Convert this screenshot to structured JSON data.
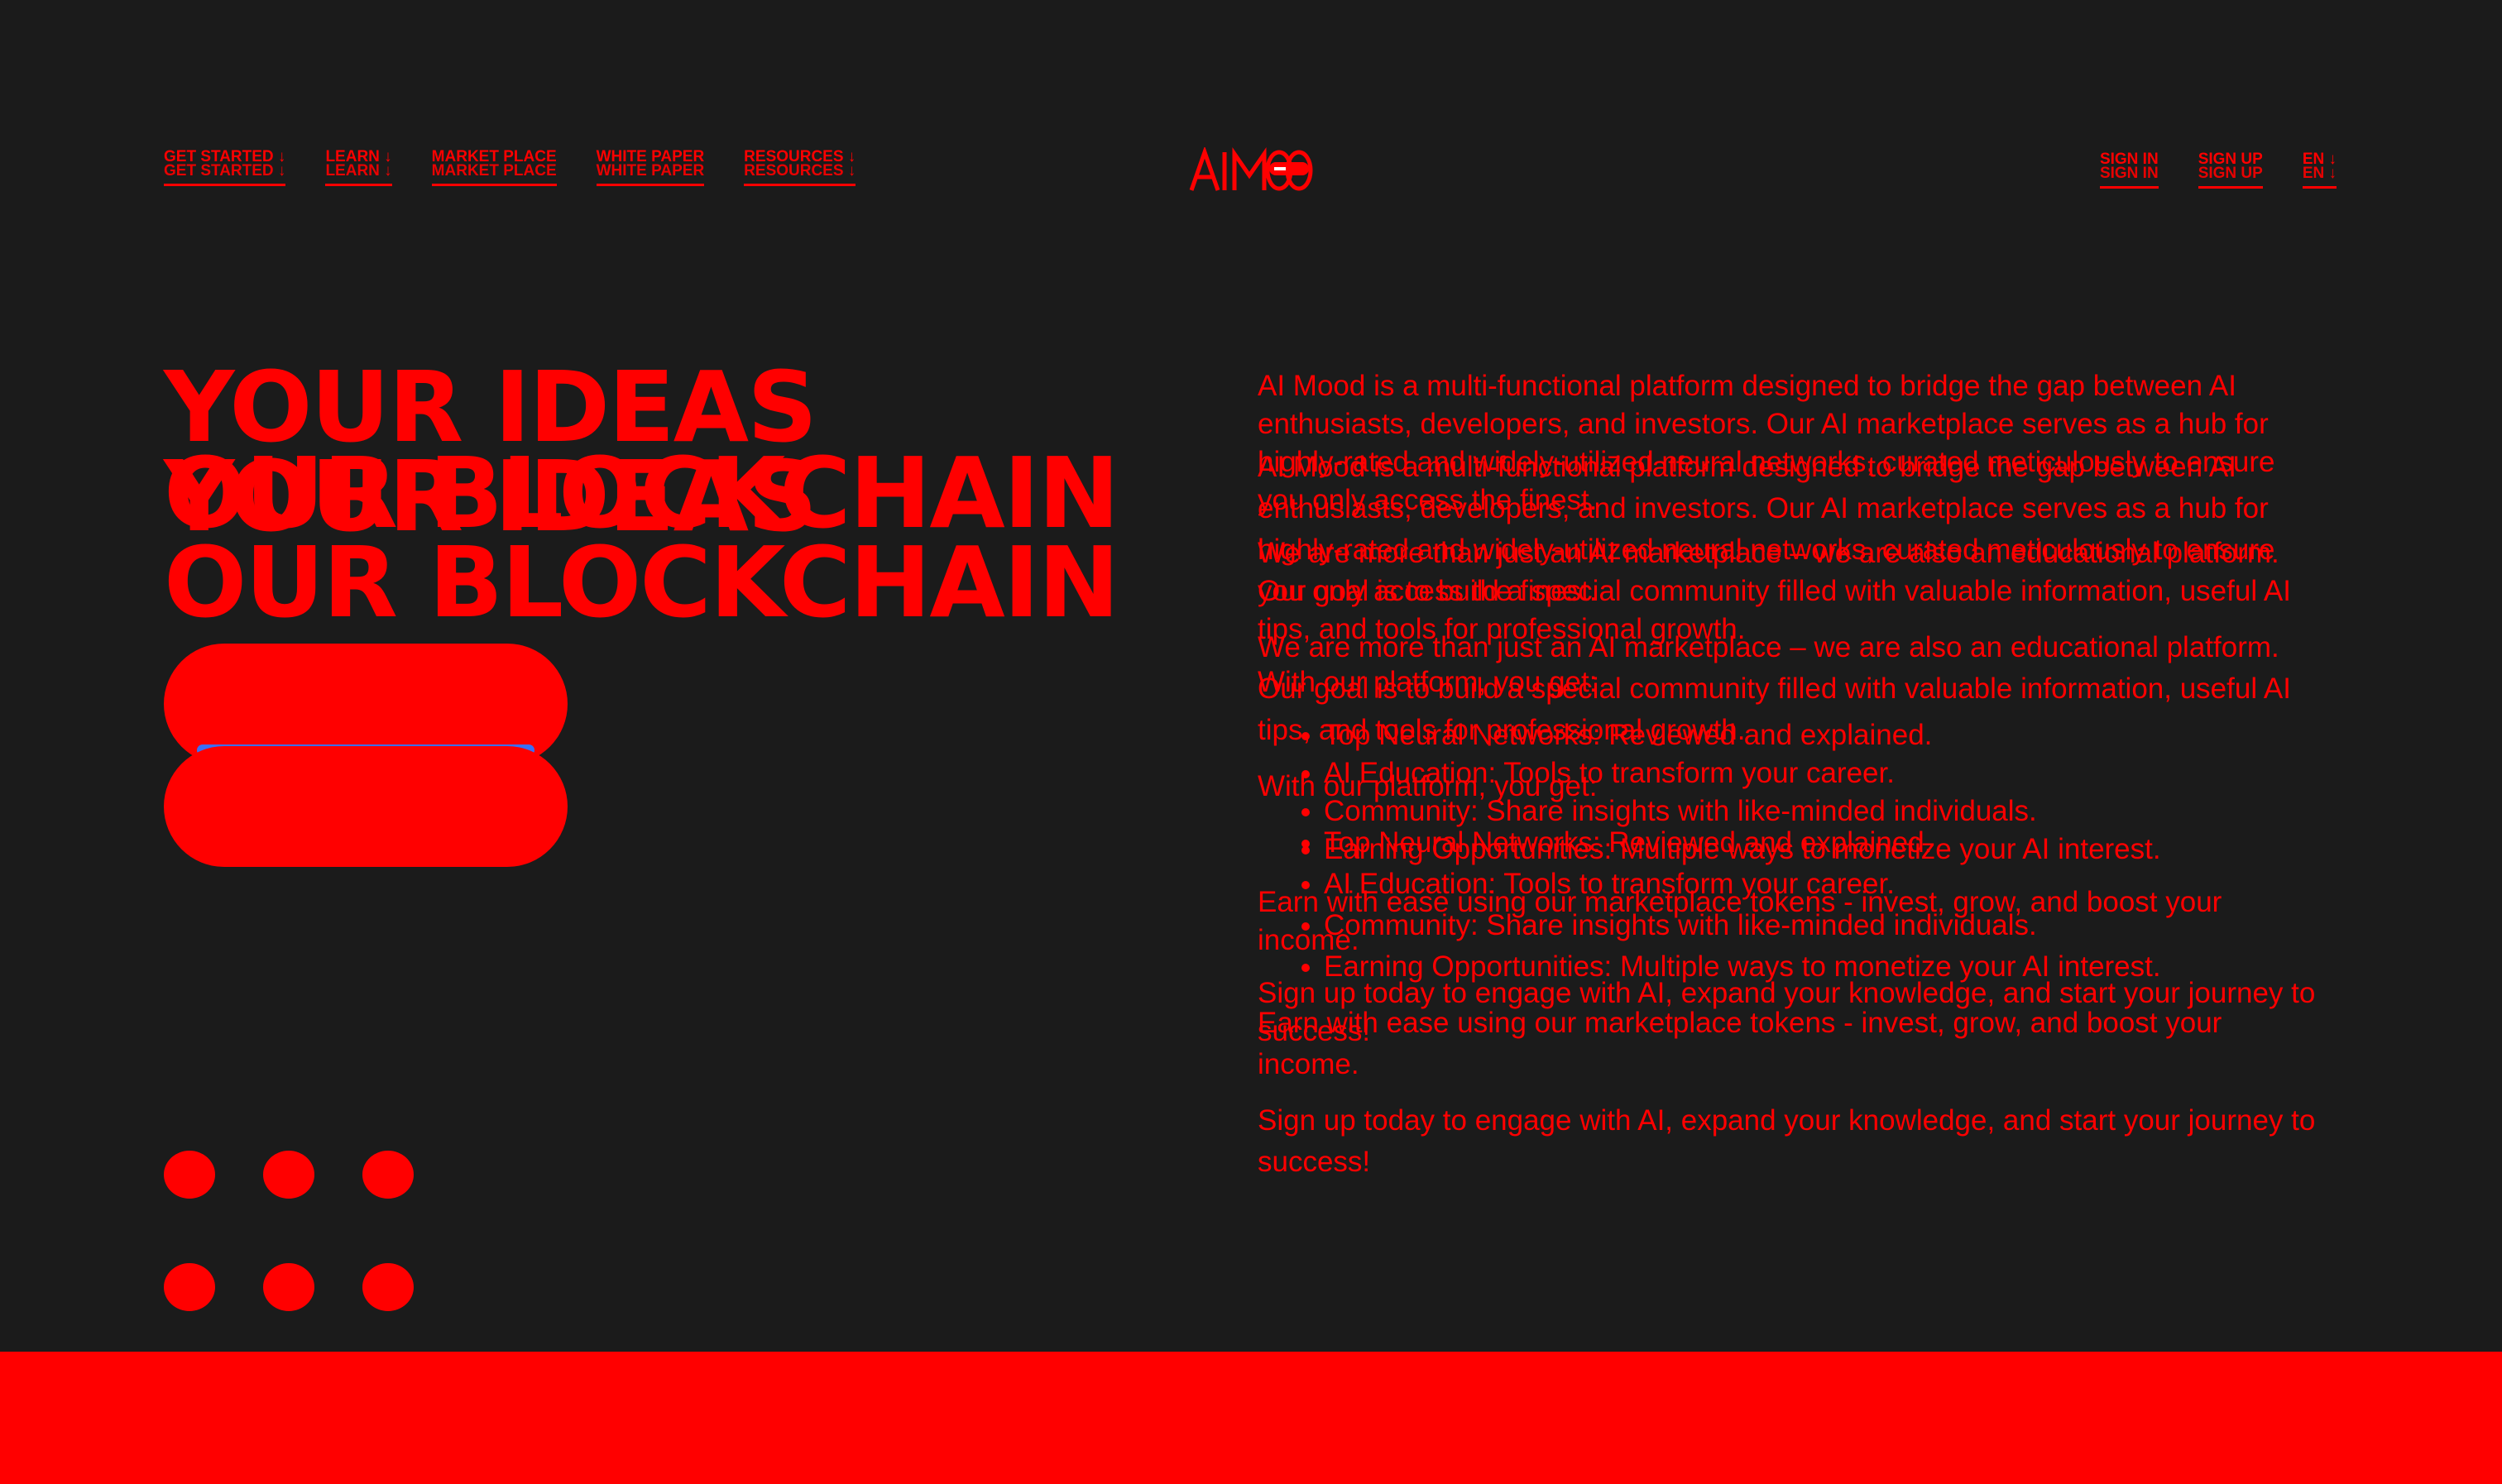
{
  "nav": {
    "left": [
      "GET STARTED ↓",
      "LEARN ↓",
      "MARKET PLACE",
      "WHITE PAPER",
      "RESOURCES ↓"
    ],
    "right": [
      "SIGN IN",
      "SIGN UP",
      "EN ↓"
    ]
  },
  "logo": {
    "text": "AI MOOD"
  },
  "hero": {
    "line1": "YOUR IDEAS",
    "line2": "OUR BLOCKCHAIN"
  },
  "copy": {
    "intro": "AI Mood is a multi-functional platform designed to bridge the gap between AI enthusiasts, developers, and investors. Our AI marketplace serves as a hub for highly-rated and widely-utilized neural networks, curated meticulously to ensure you only access the finest.",
    "education": "We are more than just an AI marketplace – we are also an educational platform. Our goal is to build a special community filled with valuable information, useful AI tips, and tools for professional growth.",
    "platform_heading": "With our platform, you get:",
    "benefits": [
      "Top Neural Networks: Reviewed and explained.",
      "AI Education: Tools to transform your career.",
      "Community: Share insights with like-minded individuals.",
      "Earning Opportunities: Multiple ways to monetize your AI interest."
    ],
    "earn": "Earn with ease using our marketplace tokens - invest, grow, and boost your income.",
    "signup": "Sign up today to engage with AI, expand your knowledge, and start your journey to success!"
  },
  "colors": {
    "background": "#1b1b1b",
    "accent": "#ff0000",
    "highlight": "#3a6ff7",
    "white": "#ffffff"
  },
  "icons": {
    "dropdown": "chevron-down-icon",
    "logo": "ai-mood-logo-icon"
  }
}
